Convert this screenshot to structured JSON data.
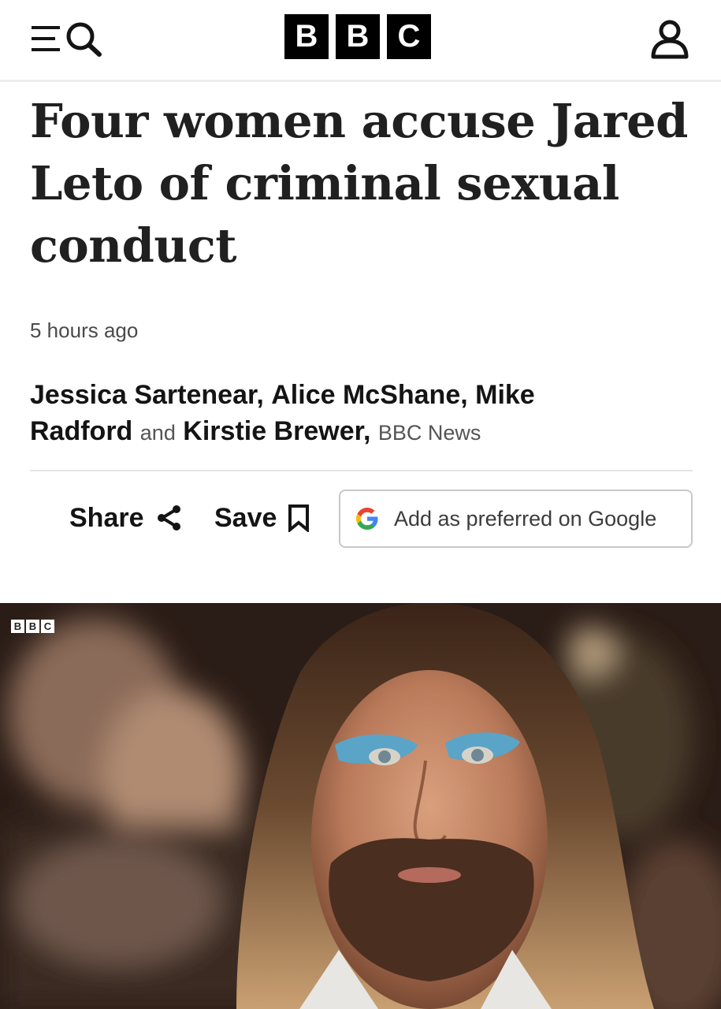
{
  "header": {
    "brand_letters": [
      "B",
      "B",
      "C"
    ],
    "menu_icon": "menu-icon",
    "search_icon": "search-icon",
    "account_icon": "account-icon"
  },
  "article": {
    "headline": "Four women accuse Jared Leto of criminal sexual conduct",
    "timestamp": "5 hours ago",
    "byline": {
      "authors": [
        "Jessica Sartenear,",
        "Alice McShane,",
        "Mike Radford",
        "Kirstie Brewer,"
      ],
      "connector": "and",
      "organisation": "BBC News"
    }
  },
  "actions": {
    "share_label": "Share",
    "save_label": "Save",
    "google_label": "Add as preferred on Google"
  },
  "image": {
    "watermark_letters": [
      "B",
      "B",
      "C"
    ]
  },
  "colors": {
    "text": "#141414",
    "headline": "#202020",
    "muted": "#4a4a4a",
    "google_blue": "#4285F4",
    "google_red": "#EA4335",
    "google_yellow": "#FBBC05",
    "google_green": "#34A853"
  }
}
